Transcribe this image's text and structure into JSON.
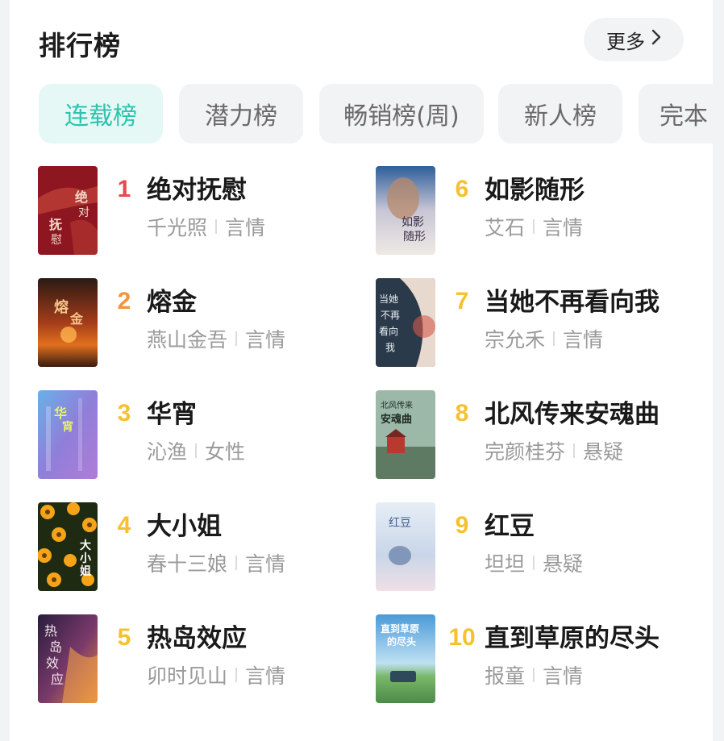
{
  "header": {
    "title": "排行榜",
    "more_label": "更多",
    "more_icon": "chevron-right-icon"
  },
  "tabs": [
    {
      "label": "连载榜",
      "active": true
    },
    {
      "label": "潜力榜",
      "active": false
    },
    {
      "label": "畅销榜(周)",
      "active": false
    },
    {
      "label": "新人榜",
      "active": false
    },
    {
      "label": "完本",
      "active": false
    }
  ],
  "colors": {
    "accent": "#2ec3ad",
    "rank1": "#e9474b",
    "rank2": "#f2963a",
    "rank_other": "#f6c12f"
  },
  "books": [
    {
      "rank": "1",
      "title": "绝对抚慰",
      "author": "千光照",
      "genre": "言情",
      "cover_text": "绝对抚慰"
    },
    {
      "rank": "2",
      "title": "熔金",
      "author": "燕山金吾",
      "genre": "言情",
      "cover_text": "熔金"
    },
    {
      "rank": "3",
      "title": "华宵",
      "author": "沁渔",
      "genre": "女性",
      "cover_text": "华宵"
    },
    {
      "rank": "4",
      "title": "大小姐",
      "author": "春十三娘",
      "genre": "言情",
      "cover_text": "大小姐"
    },
    {
      "rank": "5",
      "title": "热岛效应",
      "author": "卯时见山",
      "genre": "言情",
      "cover_text": "热岛效应"
    },
    {
      "rank": "6",
      "title": "如影随形",
      "author": "艾石",
      "genre": "言情",
      "cover_text": "如影随形"
    },
    {
      "rank": "7",
      "title": "当她不再看向我",
      "author": "宗允禾",
      "genre": "言情",
      "cover_text": "当她不再看向我"
    },
    {
      "rank": "8",
      "title": "北风传来安魂曲",
      "author": "完颜桂芬",
      "genre": "悬疑",
      "cover_text": "北风传来安魂曲"
    },
    {
      "rank": "9",
      "title": "红豆",
      "author": "坦坦",
      "genre": "悬疑",
      "cover_text": "红豆"
    },
    {
      "rank": "10",
      "title": "直到草原的尽头",
      "author": "报童",
      "genre": "言情",
      "cover_text": "直到草原的尽头"
    }
  ]
}
